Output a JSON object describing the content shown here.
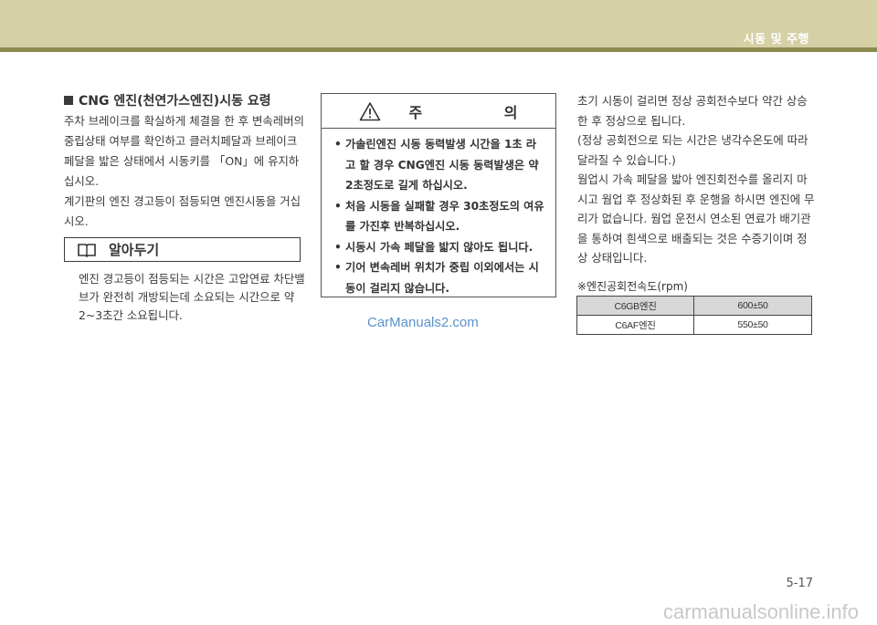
{
  "header": {
    "title": "시동 및 주행"
  },
  "cng_section": {
    "title": "CNG 엔진(천연가스엔진)시동 요령",
    "para1": "주차 브레이크를 확실하게 체결을 한 후 변속레버의 중립상태 여부를 확인하고 클러치페달과 브레이크 페달을 밟은 상태에서 시동키를 「ON」에 유지하십시오.",
    "para2": "계기판의 엔진 경고등이 점등되면 엔진시동을 거십시오."
  },
  "note": {
    "title": "알아두기",
    "text": "엔진 경고등이 점등되는 시간은 고압연료 차단밸브가 완전히 개방되는데 소요되는 시간으로 약 2~3초간 소요됩니다."
  },
  "caution": {
    "title": "주 의",
    "items": [
      "가솔린엔진 시동 동력발생 시간을 1초 라고 할 경우 CNG엔진 시동 동력발생은 약 2초정도로 길게 하십시오.",
      "처음 시동을 실패할 경우 30초정도의 여유를 가진후 반복하십시오.",
      "시동시 가속 페달을 밟지 않아도 됩니다.",
      "기어 변속레버 위치가 중립 이외에서는 시동이 걸리지 않습니다."
    ]
  },
  "watermark": "CarManuals2.com",
  "right_column": {
    "para1": "초기 시동이 걸리면 정상 공회전수보다 약간 상승한 후 정상으로 됩니다.",
    "para2": "(정상 공회전으로 되는 시간은 냉각수온도에 따라 달라질 수 있습니다.)",
    "para3": "웜업시 가속 페달을 밟아 엔진회전수를 올리지 마시고 웜업 후 정상화된 후 운행을 하시면 엔진에 무리가 없습니다. 웜업 운전시 연소된 연료가 배기관을 통하여 흰색으로 배출되는 것은 수증기이며 정상 상태입니다."
  },
  "idle_table": {
    "caption": "※엔진공회전속도(rpm)",
    "rows": [
      {
        "engine": "C6GB엔진",
        "rpm": "600±50"
      },
      {
        "engine": "C6AF엔진",
        "rpm": "550±50"
      }
    ]
  },
  "page_number": "5-17",
  "footer_watermark": "carmanualsonline.info"
}
